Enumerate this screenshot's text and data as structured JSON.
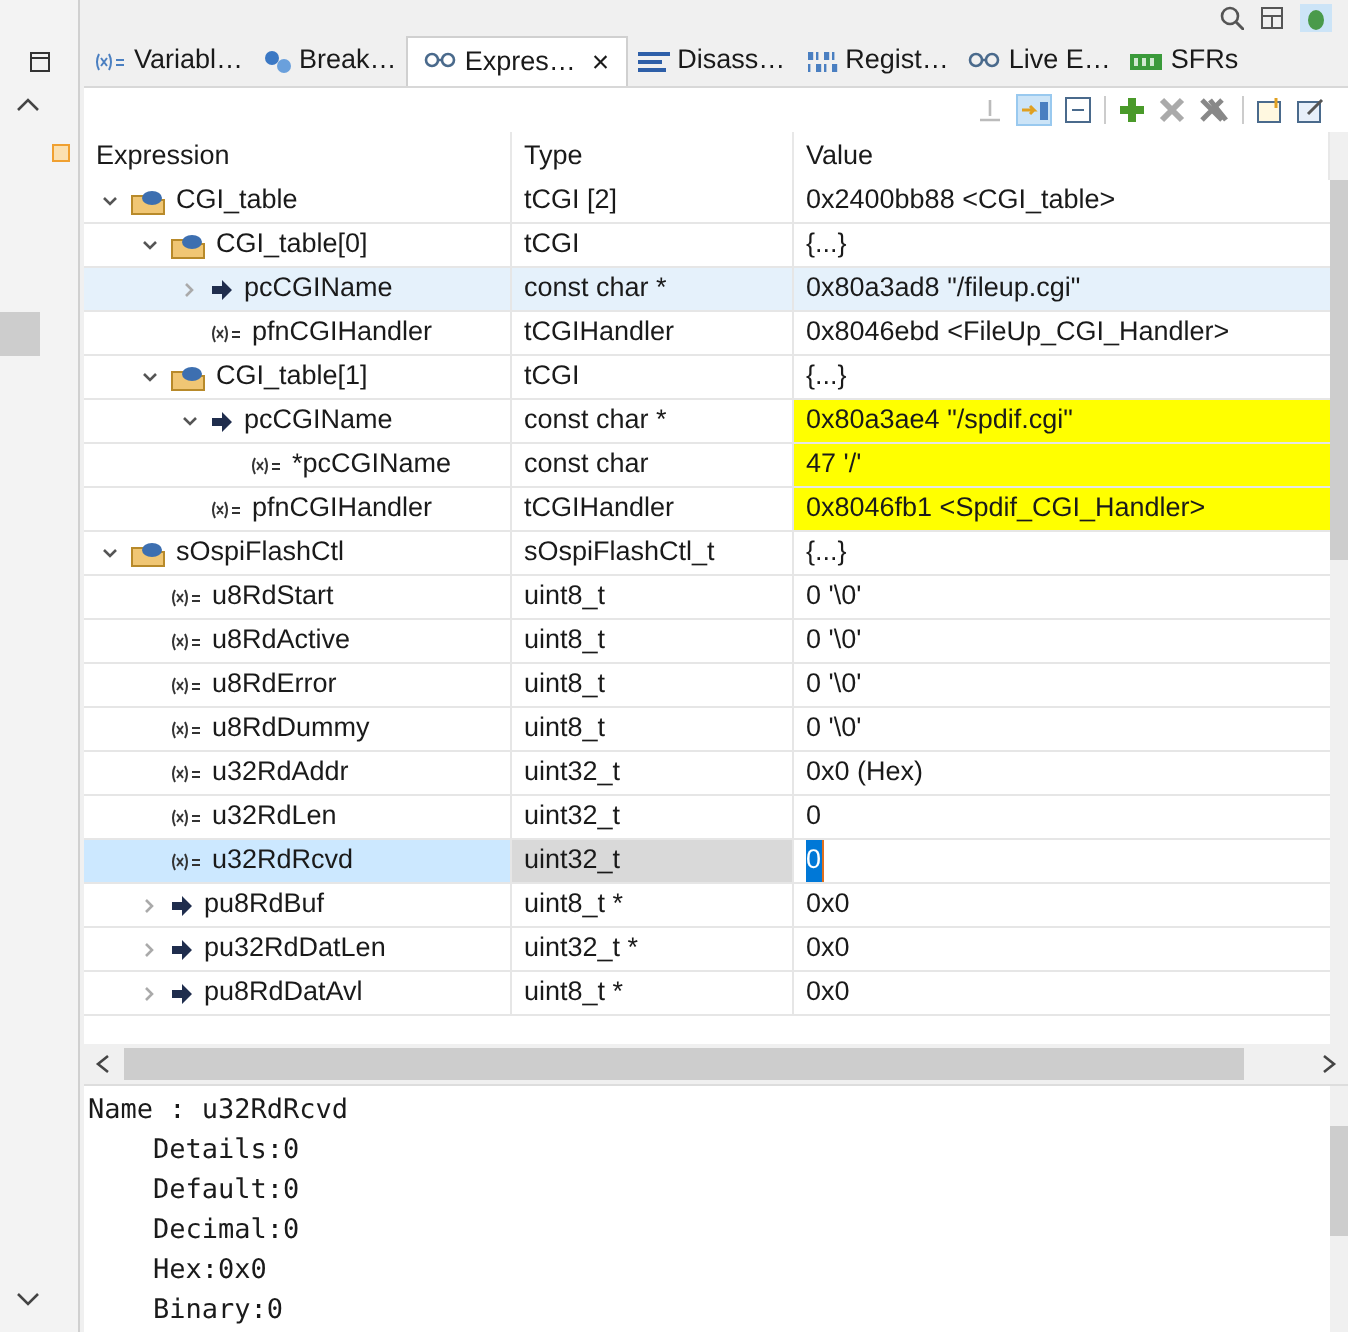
{
  "tabs": [
    {
      "label": "Variabl…",
      "kind": "variable",
      "selected": false
    },
    {
      "label": "Break…",
      "kind": "breakpoint",
      "selected": false
    },
    {
      "label": "Expres…",
      "kind": "glasses",
      "selected": true
    },
    {
      "label": "Disass…",
      "kind": "disasm",
      "selected": false
    },
    {
      "label": "Regist…",
      "kind": "binary",
      "selected": false
    },
    {
      "label": "Live E…",
      "kind": "glasses",
      "selected": false
    },
    {
      "label": "SFRs",
      "kind": "chip",
      "selected": false
    }
  ],
  "tab_close": "×",
  "columns": [
    "Expression",
    "Type",
    "Value"
  ],
  "rows": [
    {
      "name": "CGI_table",
      "type": "tCGI [2]",
      "value": "0x2400bb88 <CGI_table>",
      "kind": "struct",
      "expanded": true,
      "hovered": false,
      "selected": false,
      "changed": false,
      "children": [
        {
          "name": "CGI_table[0]",
          "type": "tCGI",
          "value": "{...}",
          "kind": "struct",
          "expanded": true,
          "hovered": false,
          "selected": false,
          "changed": false,
          "children": [
            {
              "name": "pcCGIName",
              "type": "const char *",
              "value": "0x80a3ad8 \"/fileup.cgi\"",
              "kind": "pointer",
              "expanded": false,
              "hovered": true,
              "selected": false,
              "changed": false
            },
            {
              "name": "pfnCGIHandler",
              "type": "tCGIHandler",
              "value": "0x8046ebd <FileUp_CGI_Handler>",
              "kind": "variable",
              "hovered": false,
              "selected": false,
              "changed": false
            }
          ]
        },
        {
          "name": "CGI_table[1]",
          "type": "tCGI",
          "value": "{...}",
          "kind": "struct",
          "expanded": true,
          "hovered": false,
          "selected": false,
          "changed": false,
          "children": [
            {
              "name": "pcCGIName",
              "type": "const char *",
              "value": "0x80a3ae4 \"/spdif.cgi\"",
              "kind": "pointer",
              "expanded": true,
              "hovered": false,
              "selected": false,
              "changed": true,
              "children": [
                {
                  "name": "*pcCGIName",
                  "type": "const char",
                  "value": "47 '/'",
                  "kind": "variable",
                  "hovered": false,
                  "selected": false,
                  "changed": true
                }
              ]
            },
            {
              "name": "pfnCGIHandler",
              "type": "tCGIHandler",
              "value": "0x8046fb1 <Spdif_CGI_Handler>",
              "kind": "variable",
              "hovered": false,
              "selected": false,
              "changed": true
            }
          ]
        }
      ]
    },
    {
      "name": "sOspiFlashCtl",
      "type": "sOspiFlashCtl_t",
      "value": "{...}",
      "kind": "struct",
      "expanded": true,
      "hovered": false,
      "selected": false,
      "changed": false,
      "children": [
        {
          "name": "u8RdStart",
          "type": "uint8_t",
          "value": "0 '\\0'",
          "kind": "variable",
          "hovered": false,
          "selected": false,
          "changed": false
        },
        {
          "name": "u8RdActive",
          "type": "uint8_t",
          "value": "0 '\\0'",
          "kind": "variable",
          "hovered": false,
          "selected": false,
          "changed": false
        },
        {
          "name": "u8RdError",
          "type": "uint8_t",
          "value": "0 '\\0'",
          "kind": "variable",
          "hovered": false,
          "selected": false,
          "changed": false
        },
        {
          "name": "u8RdDummy",
          "type": "uint8_t",
          "value": "0 '\\0'",
          "kind": "variable",
          "hovered": false,
          "selected": false,
          "changed": false
        },
        {
          "name": "u32RdAddr",
          "type": "uint32_t",
          "value": "0x0 (Hex)",
          "kind": "variable",
          "hovered": false,
          "selected": false,
          "changed": false
        },
        {
          "name": "u32RdLen",
          "type": "uint32_t",
          "value": "0",
          "kind": "variable",
          "hovered": false,
          "selected": false,
          "changed": false
        },
        {
          "name": "u32RdRcvd",
          "type": "uint32_t",
          "value": "0",
          "kind": "variable",
          "hovered": false,
          "selected": true,
          "changed": false
        },
        {
          "name": "pu8RdBuf",
          "type": "uint8_t *",
          "value": "0x0",
          "kind": "pointer",
          "expanded": false,
          "hovered": false,
          "selected": false,
          "changed": false
        },
        {
          "name": "pu32RdDatLen",
          "type": "uint32_t *",
          "value": "0x0",
          "kind": "pointer",
          "expanded": false,
          "hovered": false,
          "selected": false,
          "changed": false
        },
        {
          "name": "pu8RdDatAvl",
          "type": "uint8_t *",
          "value": "0x0",
          "kind": "pointer",
          "expanded": false,
          "hovered": false,
          "selected": false,
          "changed": false
        }
      ]
    }
  ],
  "details": [
    "Name : u32RdRcvd",
    "    Details:0",
    "    Default:0",
    "    Decimal:0",
    "    Hex:0x0",
    "    Binary:0"
  ]
}
